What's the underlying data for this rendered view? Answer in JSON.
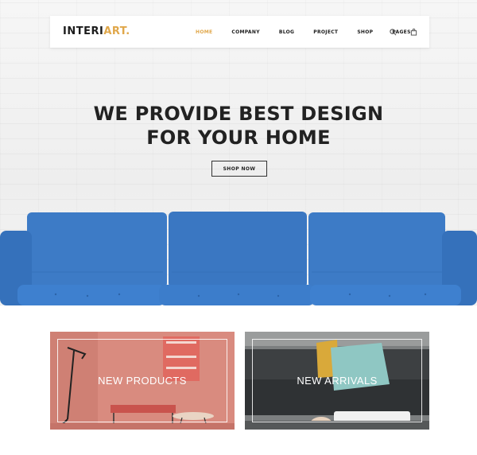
{
  "brand": {
    "logo_main": "INTERI",
    "logo_accent": "ART.",
    "accent_color": "#e0a74a"
  },
  "nav": {
    "items": [
      {
        "label": "HOME",
        "active": true
      },
      {
        "label": "COMPANY",
        "active": false
      },
      {
        "label": "BLOG",
        "active": false
      },
      {
        "label": "PROJECT",
        "active": false
      },
      {
        "label": "SHOP",
        "active": false
      },
      {
        "label": "PAGES",
        "active": false
      }
    ],
    "icons": [
      "search-icon",
      "shopping-bag-icon"
    ]
  },
  "hero": {
    "headline_line1": "WE PROVIDE BEST DESIGN",
    "headline_line2": "FOR YOUR HOME",
    "cta_label": "SHOP NOW",
    "sofa_color": "#3c78c4"
  },
  "categories": [
    {
      "title": "NEW PRODUCTS",
      "bg_color": "#d98b7f"
    },
    {
      "title": "NEW ARRIVALS",
      "bg_color": "#5c5f60"
    }
  ]
}
